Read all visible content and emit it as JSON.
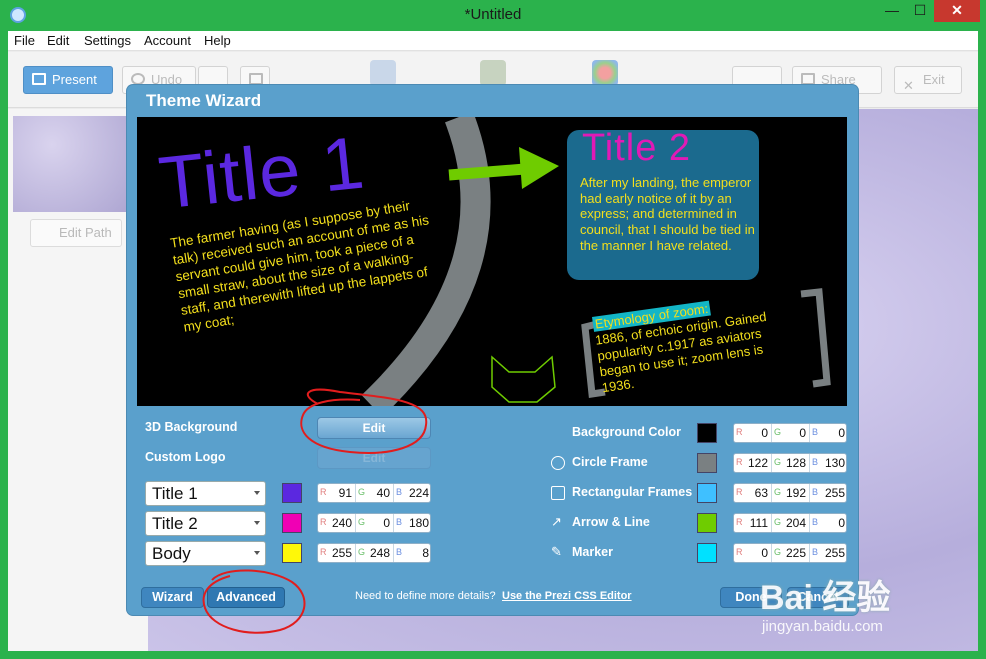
{
  "window": {
    "title": "*Untitled",
    "minimize": "—",
    "maximize": "☐",
    "close": "✕"
  },
  "menu": [
    "File",
    "Edit",
    "Settings",
    "Account",
    "Help"
  ],
  "toolbar": {
    "present": "Present",
    "undo": "Undo",
    "share": "Share",
    "exit": "Exit"
  },
  "sidebar": {
    "edit_path": "Edit Path"
  },
  "dialog": {
    "title": "Theme Wizard",
    "preview": {
      "title1": "Title 1",
      "body1": "The farmer having (as I suppose by their talk) received such an account of me as his servant could give him, took a piece of a small straw, about the size of a walking-staff, and therewith lifted up the lappets of my coat;",
      "title2": "Title 2",
      "body2": "After my landing, the emperor had early notice of it by an express; and determined in council, that I should be tied in the manner I have related.",
      "etym_highlight": "Etymology of zoom:",
      "etym_body": "1886, of echoic origin. Gained popularity c.1917 as aviators began to use it; zoom lens is 1936."
    },
    "background_3d_label": "3D Background",
    "edit_button": "Edit",
    "custom_logo_label": "Custom Logo",
    "logo_edit_button": "Edit",
    "fonts": [
      {
        "name": "Title 1",
        "color": "#5b28e0",
        "r": "91",
        "g": "40",
        "b": "224"
      },
      {
        "name": "Title 2",
        "color": "#f000b4",
        "r": "240",
        "g": "0",
        "b": "180"
      },
      {
        "name": "Body",
        "color": "#fff808",
        "r": "255",
        "g": "248",
        "b": "8"
      }
    ],
    "colors": [
      {
        "label": "Background Color",
        "icon": "none",
        "color": "#000000",
        "r": "0",
        "g": "0",
        "b": "0"
      },
      {
        "label": "Circle Frame",
        "icon": "circle-icon",
        "color": "#7a8082",
        "r": "122",
        "g": "128",
        "b": "130"
      },
      {
        "label": "Rectangular Frames",
        "icon": "rect-frames-icon",
        "color": "#3fc0ff",
        "r": "63",
        "g": "192",
        "b": "255"
      },
      {
        "label": "Arrow & Line",
        "icon": "arrow-icon",
        "color": "#6fcc00",
        "r": "111",
        "g": "204",
        "b": "0"
      },
      {
        "label": "Marker",
        "icon": "marker-icon",
        "color": "#00e1ff",
        "r": "0",
        "g": "225",
        "b": "255"
      }
    ],
    "wizard_button": "Wizard",
    "advanced_button": "Advanced",
    "footer_text": "Need to define more details?",
    "footer_link": "Use the Prezi CSS Editor",
    "done_button": "Done",
    "cancel_button": "Cancel"
  },
  "watermark": {
    "main": "Bai 经验",
    "sub": "jingyan.baidu.com"
  }
}
